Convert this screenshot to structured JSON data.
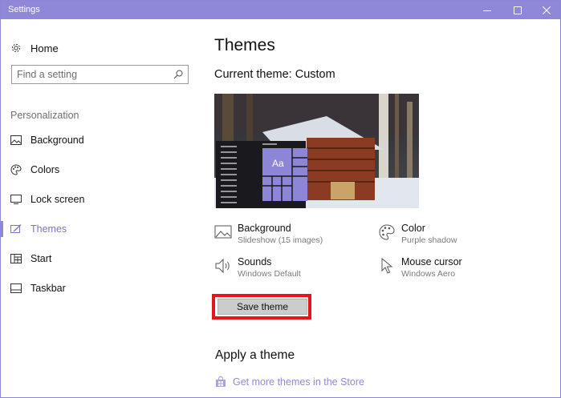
{
  "window": {
    "title": "Settings",
    "accent_color": "#8f88d9",
    "controls": [
      "minimize-icon",
      "maximize-icon",
      "close-icon"
    ]
  },
  "sidebar": {
    "home_label": "Home",
    "search_placeholder": "Find a setting",
    "section_label": "Personalization",
    "items": [
      {
        "label": "Background",
        "icon": "background-picture-icon",
        "active": false
      },
      {
        "label": "Colors",
        "icon": "palette-icon",
        "active": false
      },
      {
        "label": "Lock screen",
        "icon": "lock-screen-icon",
        "active": false
      },
      {
        "label": "Themes",
        "icon": "themes-brush-icon",
        "active": true
      },
      {
        "label": "Start",
        "icon": "start-grid-icon",
        "active": false
      },
      {
        "label": "Taskbar",
        "icon": "taskbar-icon",
        "active": false
      }
    ]
  },
  "main": {
    "title": "Themes",
    "current_theme": "Current theme: Custom",
    "preview_tile_text": "Aa",
    "properties": {
      "background": {
        "name": "Background",
        "value": "Slideshow (15 images)",
        "icon": "picture-icon"
      },
      "color": {
        "name": "Color",
        "value": "Purple shadow",
        "icon": "palette-icon"
      },
      "sounds": {
        "name": "Sounds",
        "value": "Windows Default",
        "icon": "speaker-icon"
      },
      "mouse_cursor": {
        "name": "Mouse cursor",
        "value": "Windows Aero",
        "icon": "cursor-icon"
      }
    },
    "save_button": "Save theme",
    "save_highlight_color": "#e8141b",
    "apply_title": "Apply a theme",
    "store_link": "Get more themes in the Store"
  }
}
